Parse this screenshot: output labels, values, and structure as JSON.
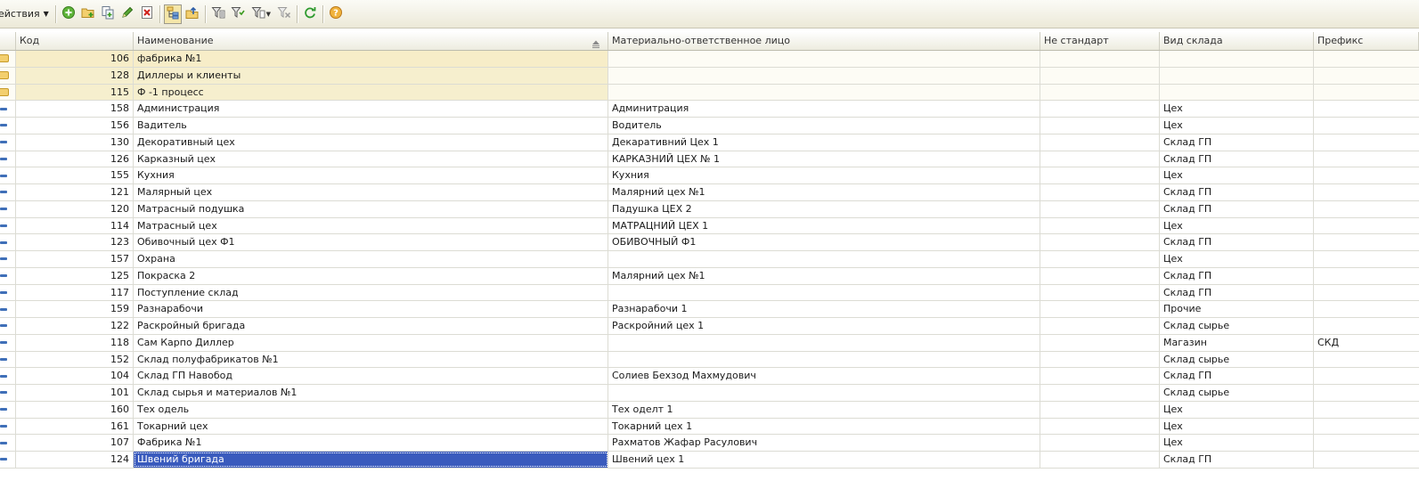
{
  "toolbar": {
    "actions_label": "ействия",
    "buttons": [
      {
        "icon": "add-icon"
      },
      {
        "icon": "add-group-icon"
      },
      {
        "icon": "copy-icon"
      },
      {
        "icon": "edit-icon"
      },
      {
        "icon": "delete-icon"
      },
      {
        "icon": "hierarchy-view-icon",
        "pressed": true
      },
      {
        "icon": "level-up-icon"
      },
      {
        "icon": "filter-icon"
      },
      {
        "icon": "filter-by-value-icon"
      },
      {
        "icon": "filter-dropdown-icon"
      },
      {
        "icon": "clear-filter-icon"
      },
      {
        "icon": "refresh-icon"
      },
      {
        "icon": "help-icon"
      }
    ]
  },
  "columns": {
    "code": "Код",
    "name": "Наименование",
    "responsible": "Материально-ответственное лицо",
    "nonstandard": "Не стандарт",
    "warehouse_type": "Вид склада",
    "prefix": "Префикс"
  },
  "rows": [
    {
      "type": "group",
      "code": "106",
      "name": "фабрика №1",
      "responsible": "",
      "nonstandard": "",
      "warehouse_type": "",
      "prefix": ""
    },
    {
      "type": "group",
      "code": "128",
      "name": "Диллеры и клиенты",
      "responsible": "",
      "nonstandard": "",
      "warehouse_type": "",
      "prefix": ""
    },
    {
      "type": "group",
      "code": "115",
      "name": "Ф -1 процесс",
      "responsible": "",
      "nonstandard": "",
      "warehouse_type": "",
      "prefix": ""
    },
    {
      "type": "item",
      "code": "158",
      "name": "Администрация",
      "responsible": "Админитрация",
      "nonstandard": "",
      "warehouse_type": "Цех",
      "prefix": ""
    },
    {
      "type": "item",
      "code": "156",
      "name": "Вадитель",
      "responsible": "Водитель",
      "nonstandard": "",
      "warehouse_type": "Цех",
      "prefix": ""
    },
    {
      "type": "item",
      "code": "130",
      "name": "Декоративный цех",
      "responsible": "Декаративний Цех  1",
      "nonstandard": "",
      "warehouse_type": "Склад ГП",
      "prefix": ""
    },
    {
      "type": "item",
      "code": "126",
      "name": "Карказный цех",
      "responsible": "КАРКАЗНИЙ  ЦЕХ № 1",
      "nonstandard": "",
      "warehouse_type": "Склад ГП",
      "prefix": ""
    },
    {
      "type": "item",
      "code": "155",
      "name": "Кухния",
      "responsible": "Кухния",
      "nonstandard": "",
      "warehouse_type": "Цех",
      "prefix": ""
    },
    {
      "type": "item",
      "code": "121",
      "name": "Малярный цех",
      "responsible": "Малярний цех №1",
      "nonstandard": "",
      "warehouse_type": "Склад ГП",
      "prefix": ""
    },
    {
      "type": "item",
      "code": "120",
      "name": "Матрасный подушка",
      "responsible": "Падушка  ЦЕХ 2",
      "nonstandard": "",
      "warehouse_type": "Склад ГП",
      "prefix": ""
    },
    {
      "type": "item",
      "code": "114",
      "name": "Матрасный цех",
      "responsible": "МАТРАЦНИЙ ЦЕХ 1",
      "nonstandard": "",
      "warehouse_type": "Цех",
      "prefix": ""
    },
    {
      "type": "item",
      "code": "123",
      "name": "Обивочный цех Ф1",
      "responsible": "ОБИВОЧНЫЙ  Ф1",
      "nonstandard": "",
      "warehouse_type": "Склад ГП",
      "prefix": ""
    },
    {
      "type": "item",
      "code": "157",
      "name": "Охрана",
      "responsible": "",
      "nonstandard": "",
      "warehouse_type": "Цех",
      "prefix": ""
    },
    {
      "type": "item",
      "code": "125",
      "name": "Покраска 2",
      "responsible": "Малярний цех №1",
      "nonstandard": "",
      "warehouse_type": "Склад ГП",
      "prefix": ""
    },
    {
      "type": "item",
      "code": "117",
      "name": "Поступление  склад",
      "responsible": "",
      "nonstandard": "",
      "warehouse_type": "Склад ГП",
      "prefix": ""
    },
    {
      "type": "item",
      "code": "159",
      "name": "Разнарабочи",
      "responsible": "Разнарабочи 1",
      "nonstandard": "",
      "warehouse_type": "Прочие",
      "prefix": ""
    },
    {
      "type": "item",
      "code": "122",
      "name": "Раскройный бригада",
      "responsible": "Раскройний цех 1",
      "nonstandard": "",
      "warehouse_type": "Склад сырье",
      "prefix": ""
    },
    {
      "type": "item",
      "code": "118",
      "name": "Сам Карпо Диллер",
      "responsible": "",
      "nonstandard": "",
      "warehouse_type": "Магазин",
      "prefix": "СКД"
    },
    {
      "type": "item",
      "code": "152",
      "name": "Склад  полуфабрикатов  №1",
      "responsible": "",
      "nonstandard": "",
      "warehouse_type": "Склад сырье",
      "prefix": ""
    },
    {
      "type": "item",
      "code": "104",
      "name": "Склад ГП Навобод",
      "responsible": "Солиев Бехзод Махмудович",
      "nonstandard": "",
      "warehouse_type": "Склад ГП",
      "prefix": ""
    },
    {
      "type": "item",
      "code": "101",
      "name": "Склад сырья и материалов №1",
      "responsible": "",
      "nonstandard": "",
      "warehouse_type": "Склад сырье",
      "prefix": ""
    },
    {
      "type": "item",
      "code": "160",
      "name": "Тех одель",
      "responsible": "Тех оделт 1",
      "nonstandard": "",
      "warehouse_type": "Цех",
      "prefix": ""
    },
    {
      "type": "item",
      "code": "161",
      "name": "Токарний цех",
      "responsible": "Токарний цех 1",
      "nonstandard": "",
      "warehouse_type": "Цех",
      "prefix": ""
    },
    {
      "type": "item",
      "code": "107",
      "name": "Фабрика №1",
      "responsible": "Рахматов Жафар Расулович",
      "nonstandard": "",
      "warehouse_type": "Цех",
      "prefix": ""
    },
    {
      "type": "item",
      "code": "124",
      "name": "Швений бригада",
      "responsible": "Швений цех 1",
      "nonstandard": "",
      "warehouse_type": "Склад ГП",
      "prefix": "",
      "selected": true
    }
  ]
}
